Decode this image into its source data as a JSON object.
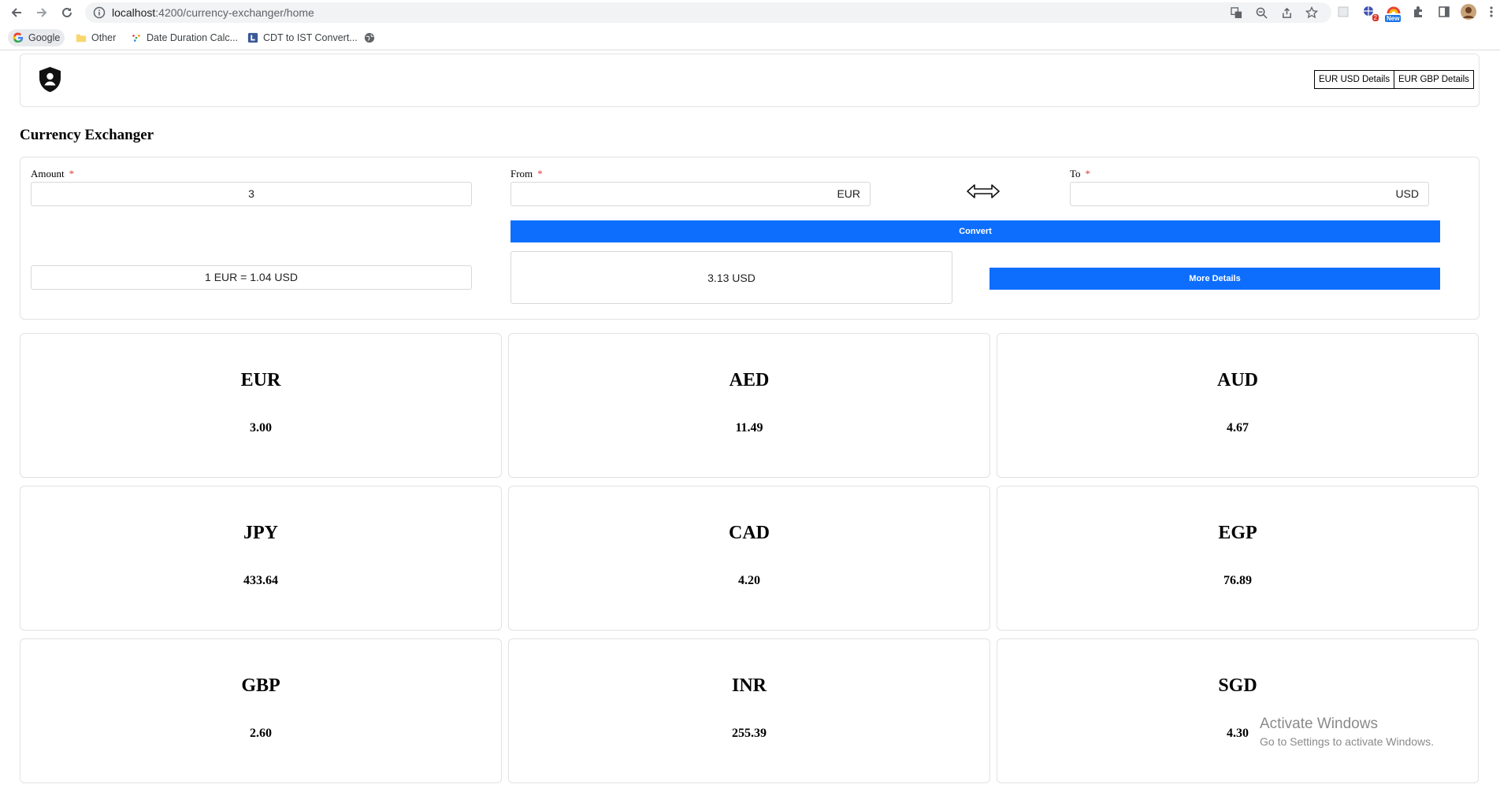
{
  "browser": {
    "url_host": "localhost",
    "url_rest": ":4200/currency-exchanger/home",
    "ext_badge_count": "2",
    "ext_badge_new": "New",
    "bookmarks": [
      {
        "label": "Google",
        "icon": "google-icon"
      },
      {
        "label": "Other",
        "icon": "folder-icon"
      },
      {
        "label": "Date Duration Calc...",
        "icon": "calendar-icon"
      },
      {
        "label": "CDT to IST Convert...",
        "icon": "clock-icon"
      },
      {
        "label": "",
        "icon": "globe-icon"
      }
    ]
  },
  "header": {
    "logo_icon": "shield-user-icon",
    "buttons": [
      "EUR USD Details",
      "EUR GBP Details"
    ]
  },
  "page": {
    "title": "Currency Exchanger"
  },
  "converter": {
    "amount_label": "Amount",
    "amount_value": "3",
    "from_label": "From",
    "from_value": "EUR",
    "to_label": "To",
    "to_value": "USD",
    "required_mark": "*",
    "swap_icon": "swap-arrows-icon",
    "convert_label": "Convert",
    "rate_text": "1 EUR = 1.04 USD",
    "result_text": "3.13 USD",
    "more_details_label": "More Details",
    "accent_color": "#0d6efd"
  },
  "currencies": [
    {
      "code": "EUR",
      "value": "3.00"
    },
    {
      "code": "AED",
      "value": "11.49"
    },
    {
      "code": "AUD",
      "value": "4.67"
    },
    {
      "code": "JPY",
      "value": "433.64"
    },
    {
      "code": "CAD",
      "value": "4.20"
    },
    {
      "code": "EGP",
      "value": "76.89"
    },
    {
      "code": "GBP",
      "value": "2.60"
    },
    {
      "code": "INR",
      "value": "255.39"
    },
    {
      "code": "SGD",
      "value": "4.30"
    }
  ],
  "watermark": {
    "line1": "Activate Windows",
    "line2": "Go to Settings to activate Windows."
  }
}
